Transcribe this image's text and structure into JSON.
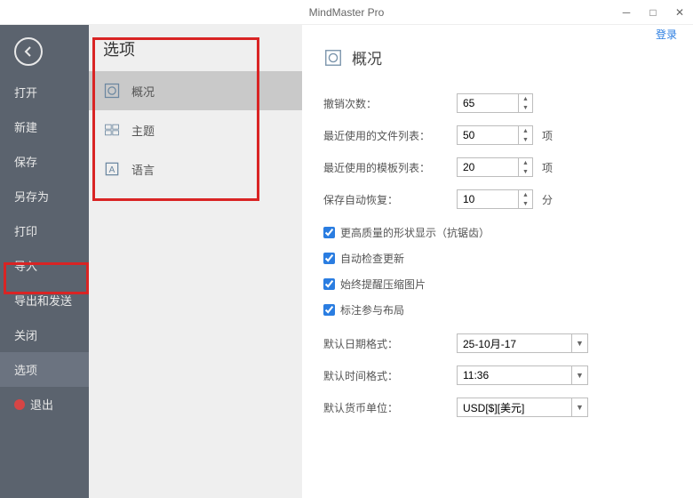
{
  "app": {
    "title": "MindMaster Pro",
    "login": "登录"
  },
  "sidebar": {
    "items": [
      {
        "label": "打开"
      },
      {
        "label": "新建"
      },
      {
        "label": "保存"
      },
      {
        "label": "另存为"
      },
      {
        "label": "打印"
      },
      {
        "label": "导入"
      },
      {
        "label": "导出和发送"
      },
      {
        "label": "关闭"
      },
      {
        "label": "选项"
      },
      {
        "label": "退出"
      }
    ]
  },
  "subpanel": {
    "title": "选项",
    "items": [
      {
        "label": "概况"
      },
      {
        "label": "主题"
      },
      {
        "label": "语言"
      }
    ]
  },
  "content": {
    "title": "概况",
    "fields": {
      "undo_label": "撤销次数：",
      "undo_value": "65",
      "recent_files_label": "最近使用的文件列表：",
      "recent_files_value": "50",
      "recent_files_unit": "项",
      "recent_templates_label": "最近使用的模板列表：",
      "recent_templates_value": "20",
      "recent_templates_unit": "项",
      "autosave_label": "保存自动恢复：",
      "autosave_value": "10",
      "autosave_unit": "分"
    },
    "checks": {
      "hq_shapes": "更高质量的形状显示（抗锯齿）",
      "auto_update": "自动检查更新",
      "compress_img": "始终提醒压缩图片",
      "label_layout": "标注参与布局"
    },
    "formats": {
      "date_label": "默认日期格式：",
      "date_value": "25-10月-17",
      "time_label": "默认时间格式：",
      "time_value": "11:36",
      "currency_label": "默认货币单位：",
      "currency_value": "USD[$][美元]"
    }
  }
}
